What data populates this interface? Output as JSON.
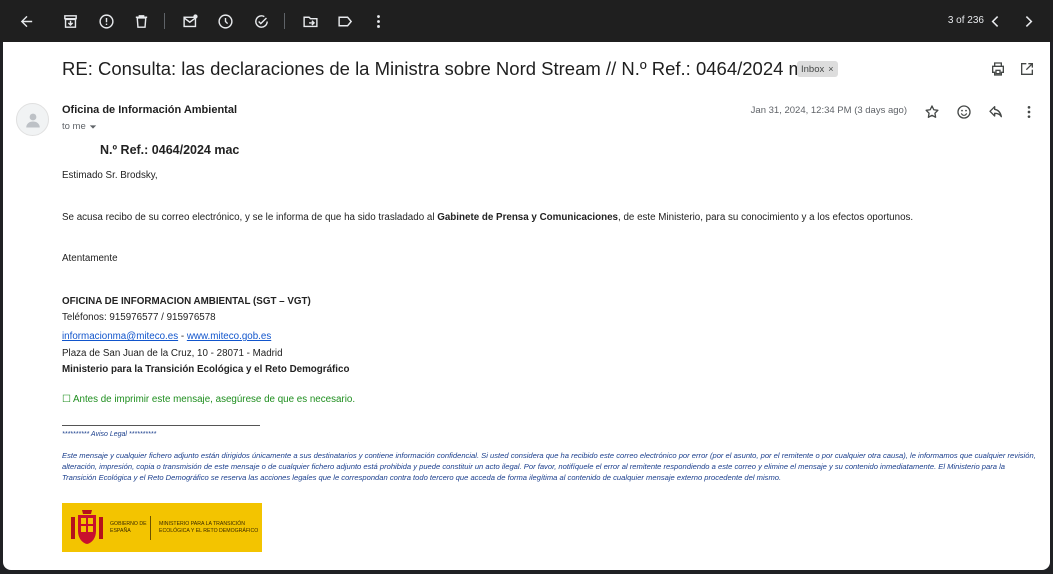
{
  "toolbar": {
    "counter": "3 of 236"
  },
  "email": {
    "subject": "RE: Consulta: las declaraciones de la Ministra sobre Nord Stream // N.º Ref.: 0464/2024 mac",
    "label_chip": "Inbox",
    "label_chip_close": "×",
    "sender": "Oficina de Información Ambiental",
    "to_me": "to me",
    "date": "Jan 31, 2024, 12:34 PM (3 days ago)"
  },
  "body": {
    "ref": "N.º Ref.: 0464/2024 mac",
    "greeting": "Estimado Sr. Brodsky,",
    "p1_before": "Se acusa recibo de su correo electrónico, y se le informa de que ha sido trasladado al ",
    "p1_bold": "Gabinete de Prensa y Comunicaciones",
    "p1_after": ", de este Ministerio, para su conocimiento y a los efectos oportunos.",
    "closing": "Atentamente",
    "office": "OFICINA DE INFORMACION AMBIENTAL (SGT – VGT)",
    "phones": "Teléfonos: 915976577 / 915976578",
    "email_link": "informacionma@miteco.es",
    "link_sep": " - ",
    "web_link": "www.miteco.gob.es",
    "address": "Plaza de San Juan de la Cruz, 10 - 28071 - Madrid",
    "ministry": "Ministerio para la Transición Ecológica y el Reto Demográfico",
    "print_notice": "☐ Antes de imprimir este mensaje, asegúrese de que es necesario.",
    "aviso": "********** Aviso Legal **********",
    "legal": "Este mensaje y cualquier fichero adjunto están dirigidos únicamente a sus destinatarios y contiene información confidencial. Si usted considera que ha recibido este correo electrónico por error (por el asunto, por el remitente o por cualquier otra causa), le informamos que cualquier revisión, alteración, impresión, copia o transmisión de este mensaje o de cualquier fichero adjunto está prohibida y puede constituir un acto ilegal. Por favor, notifíquele el error al remitente respondiendo a este correo y elimine el mensaje y su contenido inmediatamente. El Ministerio para la Transición Ecológica y el Reto Demográfico se reserva las acciones legales que le correspondan contra todo tercero que acceda de forma ilegítima al contenido de cualquier mensaje externo procedente del mismo."
  },
  "logo": {
    "left_text": "GOBIERNO DE ESPAÑA",
    "right_text": "MINISTERIO PARA LA TRANSICIÓN ECOLÓGICA Y EL RETO DEMOGRÁFICO"
  },
  "icons": {
    "toolbar": [
      "back-arrow-icon",
      "archive-icon",
      "report-spam-icon",
      "delete-icon",
      "mark-unread-icon",
      "snooze-icon",
      "add-task-icon",
      "move-to-icon",
      "label-icon",
      "more-vert-icon",
      "prev-chevron-icon",
      "next-chevron-icon"
    ],
    "header": [
      "print-icon",
      "open-new-window-icon"
    ],
    "message": [
      "avatar-person-icon",
      "star-icon",
      "emoji-icon",
      "reply-icon",
      "more-vert-icon"
    ]
  },
  "colors": {
    "toolbar_bg": "#1f1f1f",
    "link": "#1155cc",
    "legal_text": "#1a3e8c",
    "notice_green": "#1e8e1e",
    "logo_yellow": "#f3c400"
  }
}
